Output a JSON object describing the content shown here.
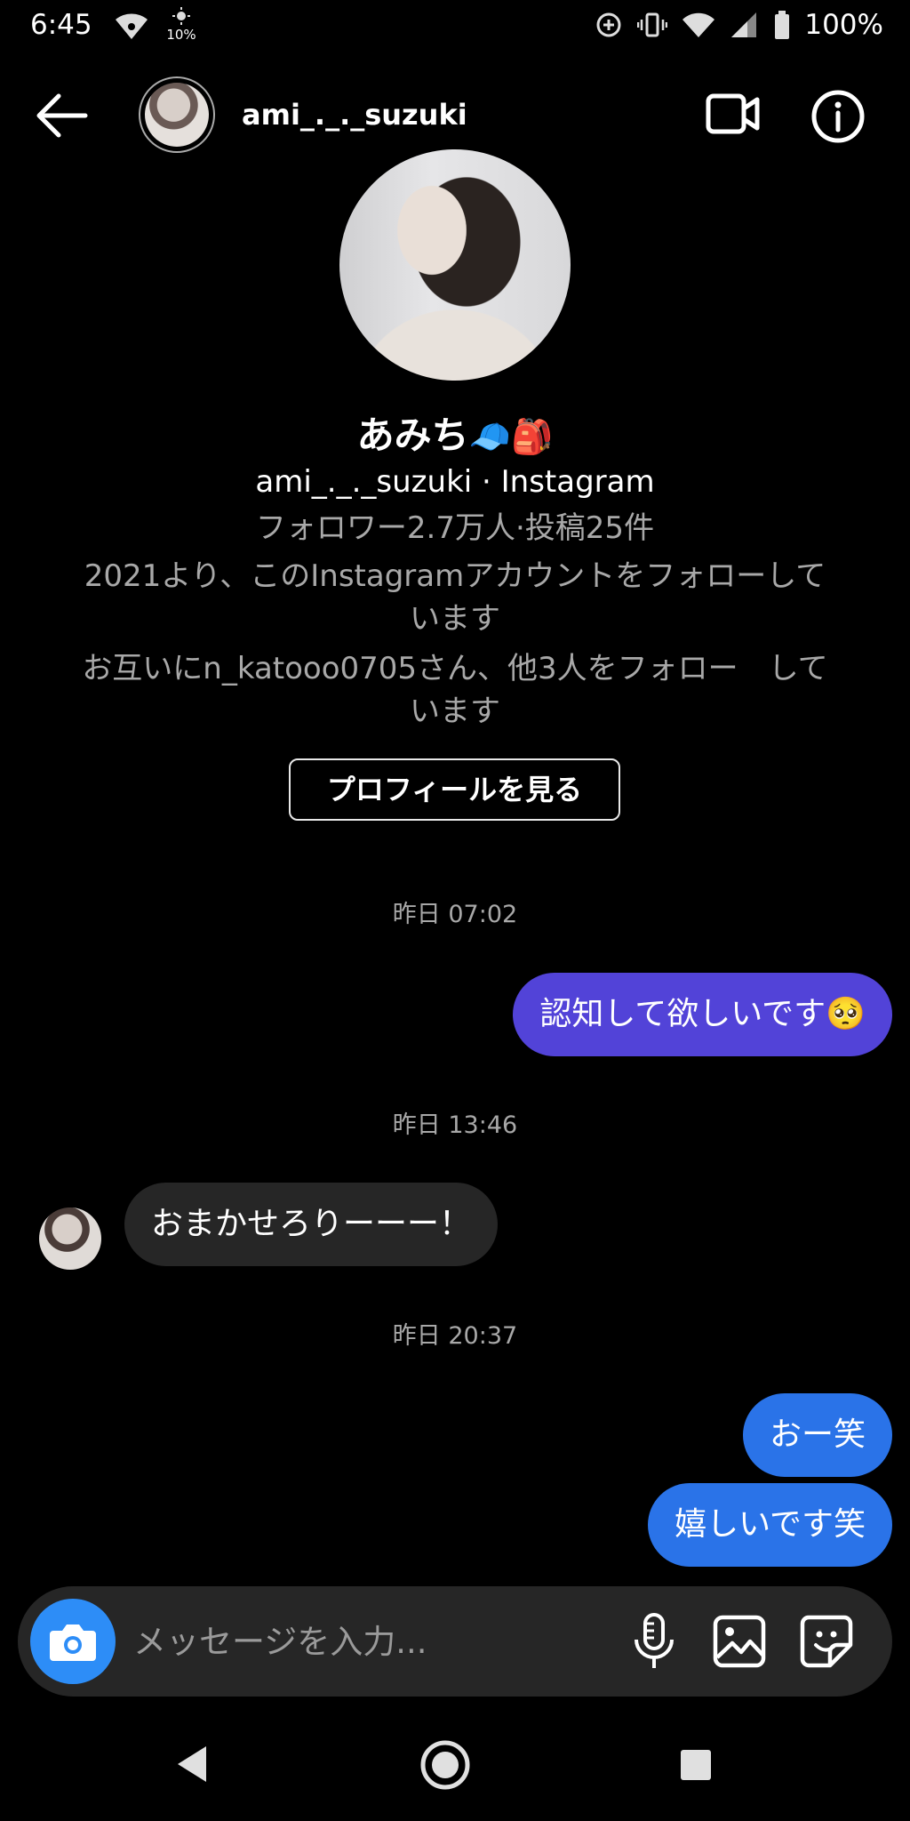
{
  "status_bar": {
    "time": "6:45",
    "brightness": "10%",
    "battery": "100%"
  },
  "header": {
    "username": "ami_._._suzuki"
  },
  "profile": {
    "display_name": "あみち",
    "name_emojis": "🧢🎒",
    "handle_line": "ami_._._suzuki · Instagram",
    "stats": "フォロワー2.7万人·投稿25件",
    "since_line1": "2021より、このInstagramアカウントをフォローして",
    "since_line2": "います",
    "mutual_line1": "お互いにn_katooo0705さん、他3人をフォロー　して",
    "mutual_line2": "います",
    "view_profile_label": "プロフィールを見る"
  },
  "messages": [
    {
      "timestamp": "昨日 07:02",
      "text": "認知して欲しいです🥺",
      "sender": "me"
    },
    {
      "timestamp": "昨日 13:46",
      "text": "おまかせろりーーー！",
      "sender": "them"
    },
    {
      "timestamp": "昨日 20:37",
      "text": "おー笑",
      "sender": "me"
    },
    {
      "timestamp": "",
      "text": "嬉しいです笑",
      "sender": "me"
    }
  ],
  "composer": {
    "placeholder": "メッセージを入力..."
  },
  "icons": {
    "back": "arrow-left-icon",
    "video": "video-call-icon",
    "info": "info-icon",
    "camera": "camera-icon",
    "mic": "microphone-icon",
    "gallery": "image-icon",
    "sticker": "sticker-icon"
  },
  "colors": {
    "background": "#000000",
    "bubble_purple": "#5243d8",
    "bubble_blue": "#2a73e8",
    "bubble_gray": "#262626",
    "camera_button": "#2d8df7"
  }
}
